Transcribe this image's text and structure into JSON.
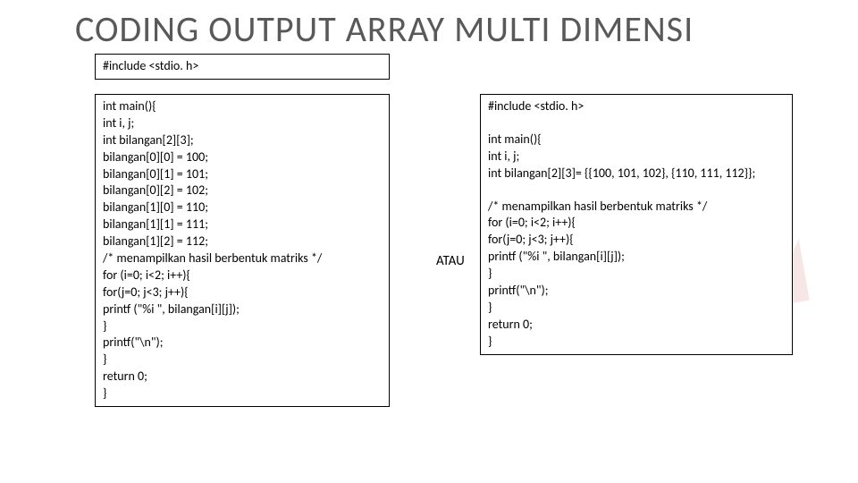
{
  "title": "CODING OUTPUT ARRAY MULTI DIMENSI",
  "connector": "ATAU",
  "include_line": "#include <stdio. h>",
  "code_left": [
    "int main(){",
    "int i, j;",
    "int bilangan[2][3];",
    "bilangan[0][0] = 100;",
    "bilangan[0][1] = 101;",
    "bilangan[0][2] = 102;",
    "bilangan[1][0] = 110;",
    "bilangan[1][1] = 111;",
    "bilangan[1][2] = 112;",
    "/* menampilkan hasil berbentuk matriks */",
    "for (i=0; i<2; i++){",
    "for(j=0; j<3; j++){",
    "printf (\"%i \", bilangan[i][j]);",
    "}",
    "printf(\"\\n\");",
    "}",
    "return 0;",
    "}"
  ],
  "code_right_block1": [
    "#include <stdio. h>"
  ],
  "code_right_block2": [
    "int main(){",
    "int i, j;",
    "int bilangan[2][3]= {{100, 101, 102}, {110, 111, 112}};"
  ],
  "code_right_block3": [
    "/* menampilkan hasil berbentuk matriks */",
    "for (i=0; i<2; i++){",
    "for(j=0; j<3; j++){",
    "printf (\"%i \", bilangan[i][j]);",
    "}",
    "printf(\"\\n\");",
    "}",
    "return 0;",
    "}"
  ]
}
